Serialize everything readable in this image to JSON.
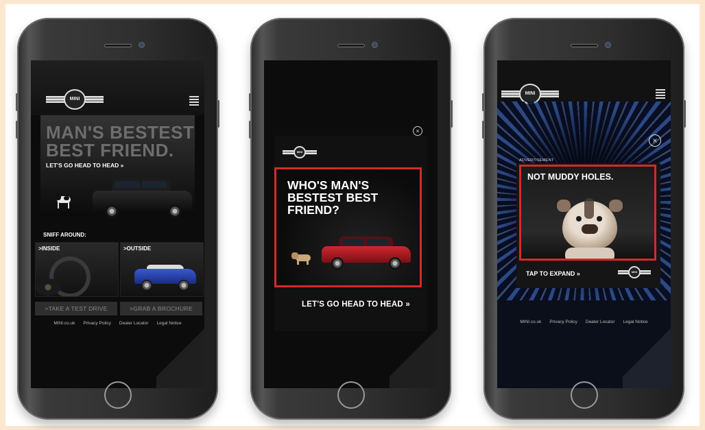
{
  "phones": [
    {
      "logo_text": "MINI",
      "hero_title_line1": "MAN'S BESTEST",
      "hero_title_line2": "BEST FRIEND.",
      "hero_cta": "LET'S GO HEAD TO HEAD »",
      "section_label": "SNIFF AROUND:",
      "tiles": [
        {
          "label": ">INSIDE"
        },
        {
          "label": ">OUTSIDE"
        }
      ],
      "buttons": [
        {
          "label": ">TAKE A TEST DRIVE"
        },
        {
          "label": ">GRAB A BROCHURE"
        }
      ],
      "footer_links": [
        "MINI.co.uk",
        "Privacy Policy",
        "Dealer Locator",
        "Legal Notice"
      ]
    },
    {
      "logo_text": "MINI",
      "close_label": "×",
      "ad_headline": "WHO'S MAN'S\nBESTEST BEST\nFRIEND?",
      "ad_cta": "LET'S GO HEAD TO HEAD »"
    },
    {
      "logo_text": "MINI",
      "close_label": "×",
      "ad_label": "ADVERTISEMENT",
      "ad_headline": "NOT MUDDY HOLES.",
      "ad_cta": "TAP TO EXPAND »",
      "footer_links": [
        "MINI.co.uk",
        "Privacy Policy",
        "Dealer Locator",
        "Legal Notice"
      ]
    }
  ],
  "colors": {
    "page_background": "#fbe7d0",
    "highlight_frame": "#d42a2a",
    "car_black": "#141414",
    "car_red": "#b81d24",
    "car_blue": "#2a46b8"
  }
}
